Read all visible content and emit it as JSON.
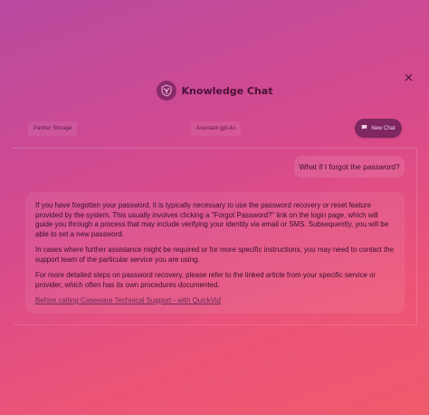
{
  "header": {
    "title": "Knowledge Chat",
    "logo_icon": "shield-network-icon",
    "close_icon": "close-icon"
  },
  "toolbar": {
    "storage_label": "Partner Storage",
    "assistant_label": "Assistant gpt-4o",
    "new_chat_label": "New Chat",
    "new_chat_icon": "chat-bubble-icon"
  },
  "chat": {
    "user_message": "What if I forgot the password?",
    "answer": {
      "p1": "If you have forgotten your password, it is typically necessary to use the password recovery or reset feature provided by the system. This usually involves clicking a \"Forgot Password?\" link on the login page, which will guide you through a process that may include verifying your identity via email or SMS. Subsequently, you will be able to set a new password.",
      "p2": "In cases where further assistance might be required or for more specific instructions, you may need to contact the support team of the particular service you are using.",
      "p3": "For more detailed steps on password recovery, please refer to the linked article from your specific service or provider, which often has its own procedures documented.",
      "link": "Before calling Caseware Technical Support - with QuickVid"
    }
  },
  "colors": {
    "accent": "#7e2760",
    "gradient_top": "#b84aa0",
    "gradient_bottom": "#ef5a6c"
  }
}
